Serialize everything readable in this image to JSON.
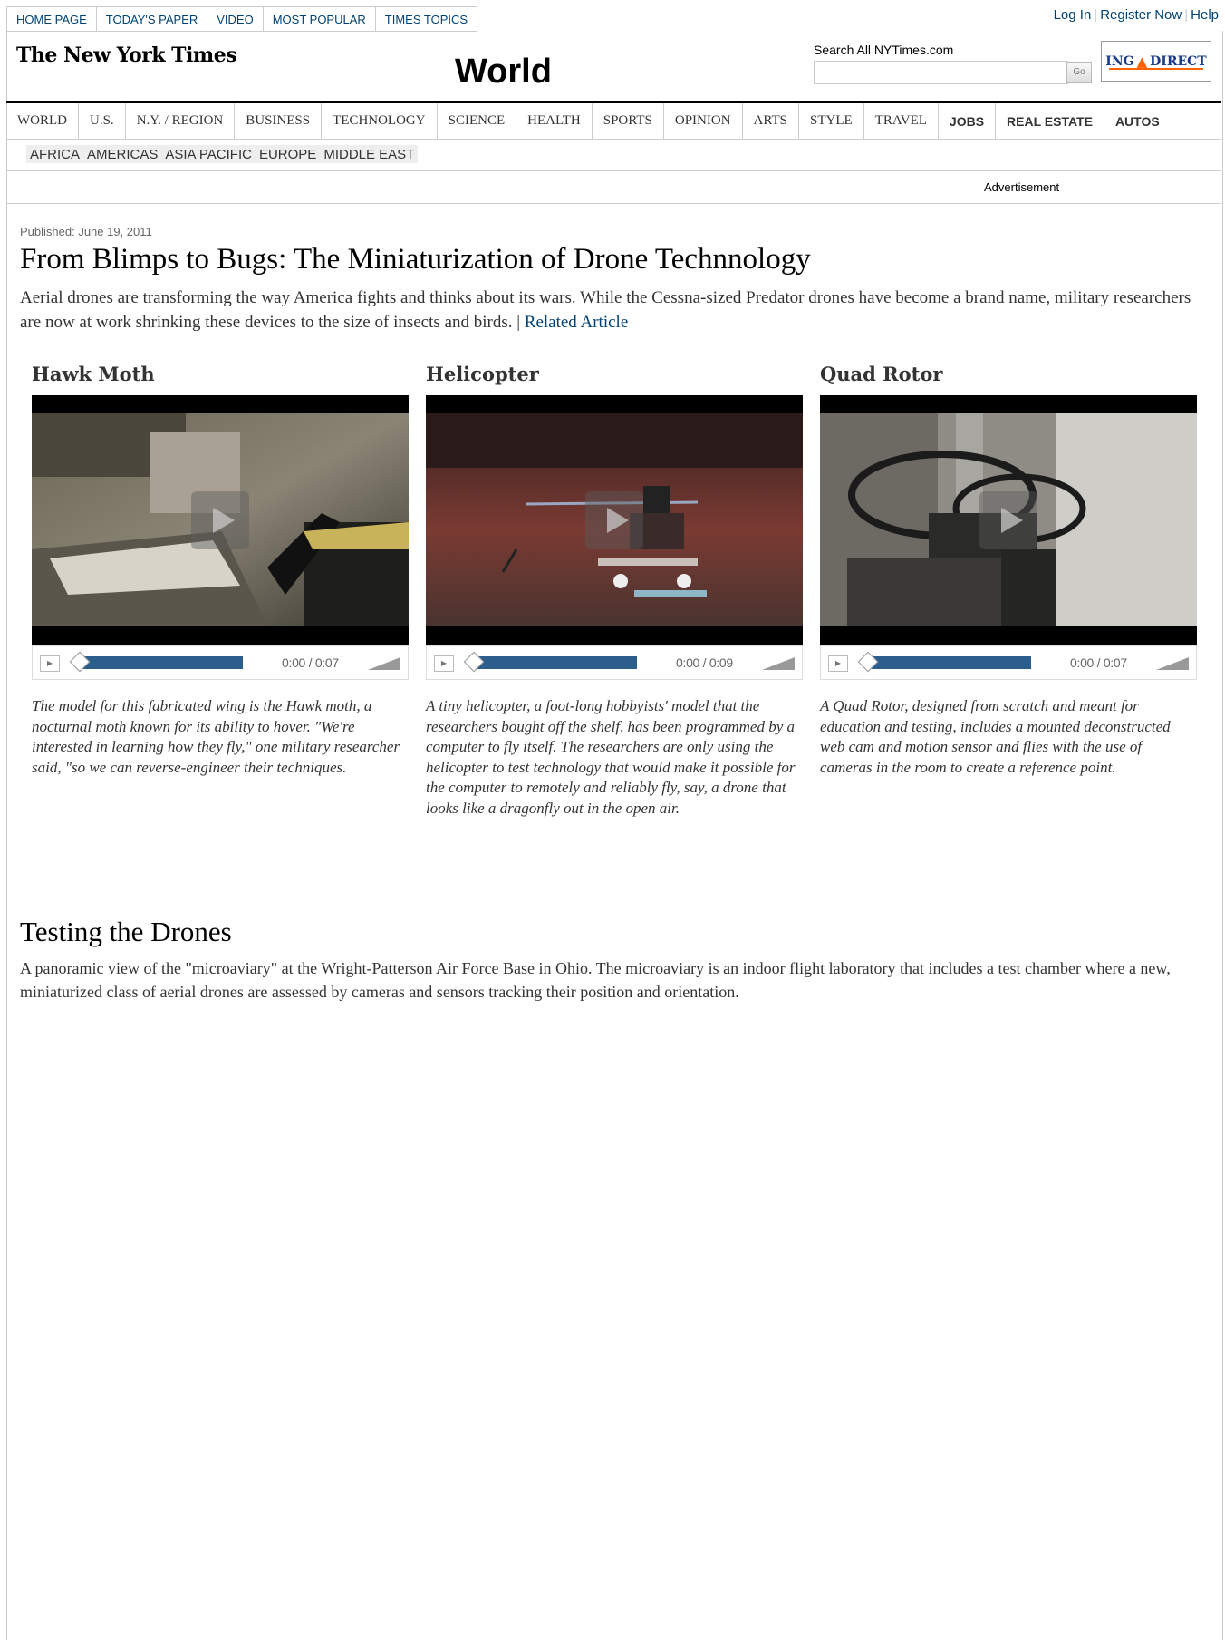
{
  "top_tabs": [
    "HOME PAGE",
    "TODAY'S PAPER",
    "VIDEO",
    "MOST POPULAR",
    "TIMES TOPICS"
  ],
  "user_links": {
    "login": "Log In",
    "register": "Register Now",
    "help": "Help"
  },
  "masthead": {
    "logo": "The New York Times",
    "section": "World"
  },
  "search": {
    "label": "Search All NYTimes.com",
    "button": "Go",
    "value": ""
  },
  "ad_logo": {
    "left": "ING",
    "right": "DIRECT"
  },
  "nav": {
    "items": [
      "WORLD",
      "U.S.",
      "N.Y. / REGION",
      "BUSINESS",
      "TECHNOLOGY",
      "SCIENCE",
      "HEALTH",
      "SPORTS",
      "OPINION",
      "ARTS",
      "STYLE",
      "TRAVEL"
    ],
    "bold_items": [
      "JOBS",
      "REAL ESTATE",
      "AUTOS"
    ]
  },
  "subnav": [
    "AFRICA",
    "AMERICAS",
    "ASIA PACIFIC",
    "EUROPE",
    "MIDDLE EAST"
  ],
  "advertisement_label": "Advertisement",
  "article": {
    "published": "Published: June 19, 2011",
    "headline": "From Blimps to Bugs: The Miniaturization of Drone Technnology",
    "summary": "Aerial drones are transforming the way America fights and thinks about its wars. While the Cessna-sized Predator drones have become a brand name, military researchers are now at work shrinking these devices to the size of insects and birds.",
    "summary_sep": " | ",
    "related_link": "Related Article"
  },
  "videos": [
    {
      "title": "Hawk Moth",
      "time": "0:00 / 0:07",
      "caption": "The model for this fabricated wing is the Hawk moth, a nocturnal moth known for its ability to hover. \"We're interested in learning how they fly,\" one military researcher said, \"so we can reverse-engineer their techniques."
    },
    {
      "title": "Helicopter",
      "time": "0:00 / 0:09",
      "caption": "A tiny helicopter, a foot-long hobbyists' model that the researchers bought off the shelf, has been programmed by a computer to fly itself. The researchers are only using the helicopter to test technology that would make it possible for the computer to remotely and reliably fly, say, a drone that looks like a dragonfly out in the open air."
    },
    {
      "title": "Quad Rotor",
      "time": "0:00 / 0:07",
      "caption": "A Quad Rotor, designed from scratch and meant for education and testing, includes a mounted deconstructed web cam and motion sensor and flies with the use of cameras in the room to create a reference point."
    }
  ],
  "section2": {
    "title": "Testing the Drones",
    "text": "A panoramic view of the \"microaviary\" at the Wright-Patterson Air Force Base in Ohio. The microaviary is an indoor flight laboratory that includes a test chamber where a new, miniaturized class of aerial drones are assessed by cameras and sensors tracking their position and orientation."
  }
}
